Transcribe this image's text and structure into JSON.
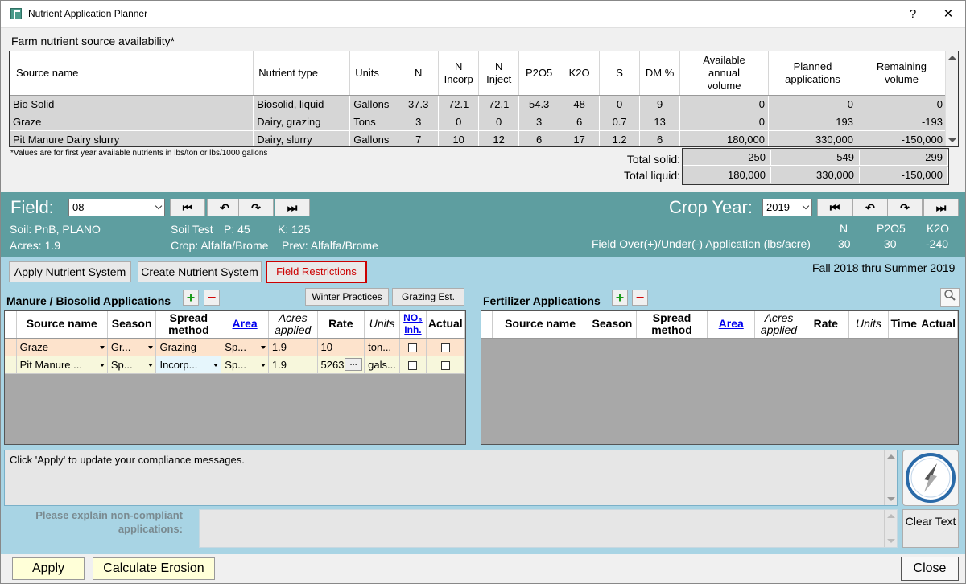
{
  "window": {
    "title": "Nutrient Application Planner",
    "help": "?",
    "close": "✕"
  },
  "sources": {
    "section_title": "Farm nutrient source availability*",
    "headers": [
      "Source name",
      "Nutrient type",
      "Units",
      "N",
      "N\nIncorp",
      "N\nInject",
      "P2O5",
      "K2O",
      "S",
      "DM %",
      "Available\nannual\nvolume",
      "Planned\napplications",
      "Remaining\nvolume"
    ],
    "rows": [
      [
        "Bio Solid",
        "Biosolid, liquid",
        "Gallons",
        "37.3",
        "72.1",
        "72.1",
        "54.3",
        "48",
        "0",
        "9",
        "0",
        "0",
        "0"
      ],
      [
        "Graze",
        "Dairy, grazing",
        "Tons",
        "3",
        "0",
        "0",
        "3",
        "6",
        "0.7",
        "13",
        "0",
        "193",
        "-193"
      ],
      [
        "Pit Manure Dairy slurry",
        "Dairy, slurry",
        "Gallons",
        "7",
        "10",
        "12",
        "6",
        "17",
        "1.2",
        "6",
        "180,000",
        "330,000",
        "-150,000"
      ]
    ],
    "footnote": "*Values are for first year available nutrients in lbs/ton or lbs/1000 gallons",
    "total_solid_label": "Total solid:",
    "total_solid": [
      "250",
      "549",
      "-299"
    ],
    "total_liquid_label": "Total liquid:",
    "total_liquid": [
      "180,000",
      "330,000",
      "-150,000"
    ]
  },
  "field": {
    "label": "Field:",
    "value": "08",
    "soil": "Soil: PnB, PLANO",
    "acres": "Acres: 1.9",
    "soil_test": "Soil Test",
    "p": "P: 45",
    "k": "K: 125",
    "crop": "Crop: Alfalfa/Brome",
    "prev": "Prev: Alfalfa/Brome",
    "crop_year_label": "Crop Year:",
    "crop_year": "2019",
    "overunder_label": "Field Over(+)/Under(-) Application (lbs/acre)",
    "nutrients": [
      "N",
      "P2O5",
      "K2O"
    ],
    "values": [
      "30",
      "30",
      "-240"
    ],
    "nav": [
      "⏮",
      "↶",
      "↷",
      "⏭"
    ]
  },
  "toolbar": {
    "apply_system": "Apply Nutrient System",
    "create_system": "Create Nutrient System",
    "field_restrictions": "Field Restrictions",
    "season_range": "Fall 2018 thru Summer 2019"
  },
  "manure": {
    "title": "Manure / Biosolid Applications",
    "winter": "Winter Practices",
    "grazing": "Grazing Est.",
    "headers": [
      "Source name",
      "Season",
      "Spread method",
      "Area",
      "Acres applied",
      "Rate",
      "Units",
      "NO₃ Inh.",
      "Actual"
    ],
    "rows": [
      {
        "source": "Graze",
        "season": "Gr...",
        "method": "Grazing",
        "area": "Sp...",
        "acres": "1.9",
        "rate": "10",
        "units": "ton..."
      },
      {
        "source": "Pit Manure ...",
        "season": "Sp...",
        "method": "Incorp...",
        "area": "Sp...",
        "acres": "1.9",
        "rate": "5263",
        "units": "gals..."
      }
    ]
  },
  "fert": {
    "title": "Fertilizer Applications",
    "headers": [
      "Source name",
      "Season",
      "Spread method",
      "Area",
      "Acres applied",
      "Rate",
      "Units",
      "Time",
      "Actual"
    ]
  },
  "messages": {
    "text": "Click 'Apply' to update your compliance messages.",
    "explain_label": "Please explain non-compliant applications:",
    "clear_text": "Clear Text"
  },
  "bottom": {
    "apply": "Apply",
    "erosion": "Calculate Erosion",
    "close": "Close"
  },
  "colors": {
    "band": "#5e9ea0",
    "lower": "#a8d4e4",
    "restrict": "#cc0000"
  }
}
